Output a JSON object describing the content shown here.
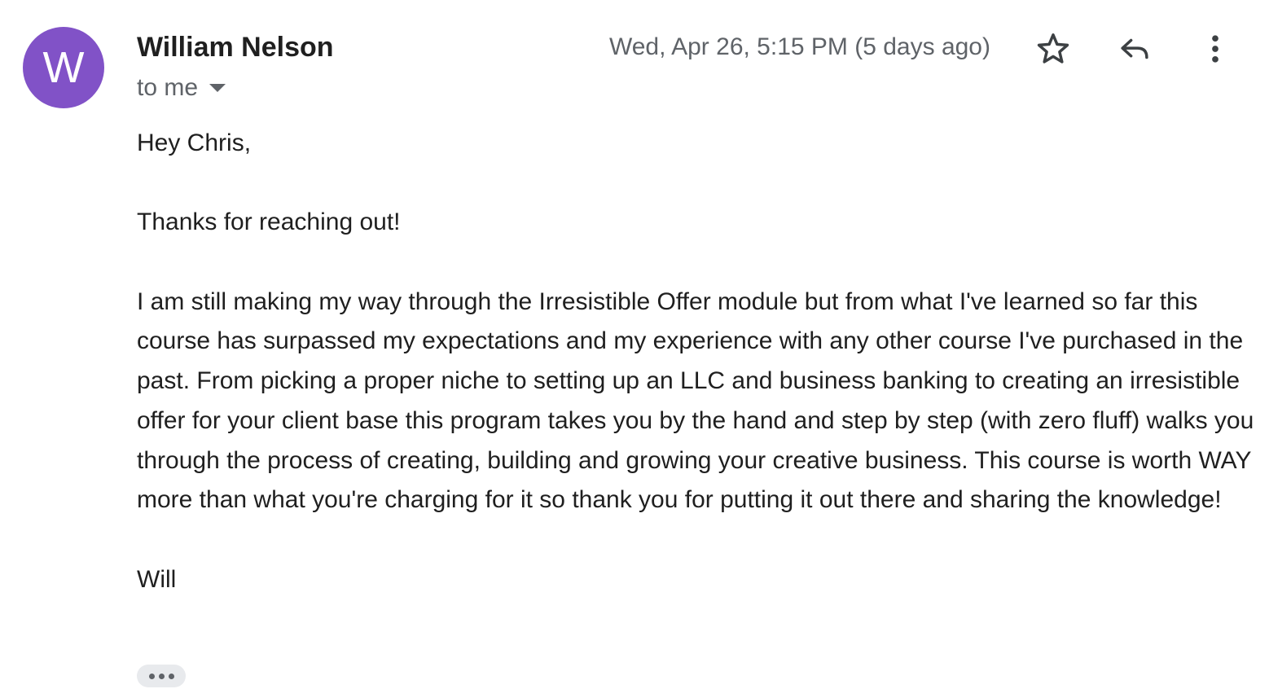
{
  "sender": {
    "avatar_letter": "W",
    "avatar_color": "#8152c7",
    "name": "William Nelson",
    "recipient_label": "to me"
  },
  "header": {
    "timestamp": "Wed, Apr 26, 5:15 PM (5 days ago)",
    "actions": [
      "star-icon",
      "reply-icon",
      "more-vert-icon"
    ]
  },
  "message": {
    "greeting": "Hey Chris,",
    "line1": "Thanks for reaching out!",
    "paragraph": "I am still making my way through the Irresistible Offer module but from what I've learned so far this course has surpassed my expectations and my experience with any other course I've purchased in the past. From picking a proper niche to setting up an LLC and business banking to creating an irresistible offer for your client base this program takes you by the hand and step by step (with zero fluff) walks you through the process of creating, building and growing your creative business. This course is worth WAY more than what you're charging for it so thank you for putting it out there and sharing the knowledge!",
    "signature": "Will"
  },
  "colors": {
    "text_primary": "#1f1f1f",
    "text_secondary": "#5f6368",
    "trimmed_bg": "#e8eaed"
  }
}
